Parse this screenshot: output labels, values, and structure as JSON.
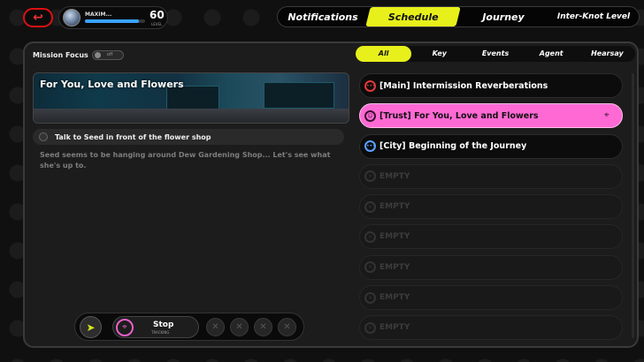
{
  "header": {
    "back_icon": "back-arrow-icon",
    "profile": {
      "name": "MAXIM...",
      "level": "60",
      "level_label": "LEVEL",
      "exp_fraction": 0.9
    },
    "tabs": [
      {
        "label": "Notifications",
        "active": false
      },
      {
        "label": "Schedule",
        "active": true
      },
      {
        "label": "Journey",
        "active": false
      },
      {
        "label": "Inter-Knot Level",
        "active": false
      }
    ]
  },
  "mission_focus": {
    "label": "Mission Focus",
    "state": "off"
  },
  "categories": [
    "All",
    "Key",
    "Events",
    "Agent",
    "Hearsay"
  ],
  "detail": {
    "title": "For You, Love and Flowers",
    "task": "Talk to Seed in front of the flower shop",
    "description": "Seed seems to be hanging around Dew Gardening Shop... Let's see what she's up to."
  },
  "actions": {
    "stop_label": "Stop",
    "stop_sub": "TRACKING"
  },
  "missions": [
    {
      "text": "[Main] Intermission Reverberations",
      "kind": "main"
    },
    {
      "text": "[Trust] For You, Love and Flowers",
      "kind": "trust"
    },
    {
      "text": "[City] Beginning of the Journey",
      "kind": "city"
    },
    {
      "text": "EMPTY",
      "kind": "empty"
    },
    {
      "text": "EMPTY",
      "kind": "empty"
    },
    {
      "text": "EMPTY",
      "kind": "empty"
    },
    {
      "text": "EMPTY",
      "kind": "empty"
    },
    {
      "text": "EMPTY",
      "kind": "empty"
    },
    {
      "text": "EMPTY",
      "kind": "empty"
    }
  ],
  "colors": {
    "accent": "#e7f01b",
    "trust": "#ff69d4",
    "main": "#e23838",
    "city": "#5aa0ff"
  }
}
